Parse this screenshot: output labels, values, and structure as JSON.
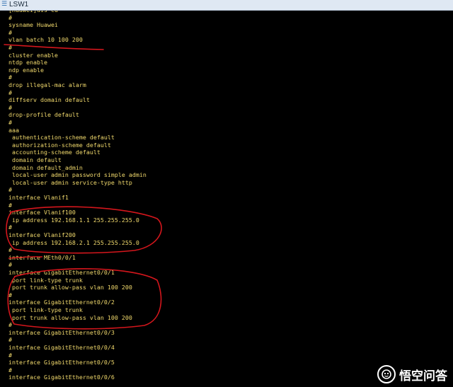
{
  "window": {
    "title": "LSW1",
    "icon": "switch-app-icon"
  },
  "terminal": {
    "text_color": "#f1d96c",
    "background": "#000000",
    "lines": [
      "[Huawei]dis cu",
      "#",
      "sysname Huawei",
      "#",
      "vlan batch 10 100 200",
      "#",
      "cluster enable",
      "ntdp enable",
      "ndp enable",
      "#",
      "drop illegal-mac alarm",
      "#",
      "diffserv domain default",
      "#",
      "drop-profile default",
      "#",
      "aaa",
      " authentication-scheme default",
      " authorization-scheme default",
      " accounting-scheme default",
      " domain default",
      " domain default_admin",
      " local-user admin password simple admin",
      " local-user admin service-type http",
      "#",
      "interface Vlanif1",
      "#",
      "interface Vlanif100",
      " ip address 192.168.1.1 255.255.255.0",
      "#",
      "interface Vlanif200",
      " ip address 192.168.2.1 255.255.255.0",
      "#",
      "interface MEth0/0/1",
      "#",
      "interface GigabitEthernet0/0/1",
      " port link-type trunk",
      " port trunk allow-pass vlan 100 200",
      "#",
      "interface GigabitEthernet0/0/2",
      " port link-type trunk",
      " port trunk allow-pass vlan 100 200",
      "#",
      "interface GigabitEthernet0/0/3",
      "#",
      "interface GigabitEthernet0/0/4",
      "#",
      "interface GigabitEthernet0/0/5",
      "#",
      "interface GigabitEthernet0/0/6"
    ]
  },
  "annotations": {
    "color": "#d4161c"
  },
  "watermark": {
    "text": "悟空问答",
    "icon": "wukong-logo-icon"
  }
}
